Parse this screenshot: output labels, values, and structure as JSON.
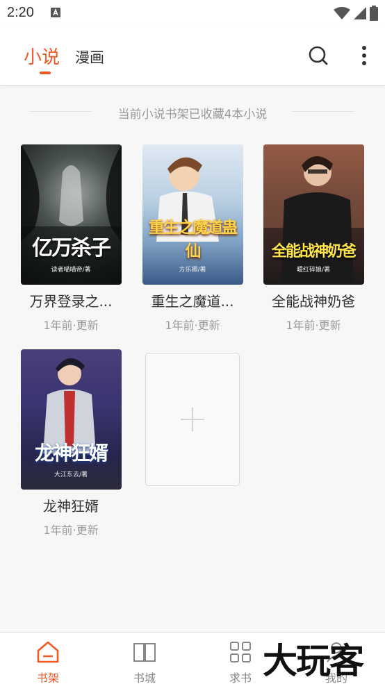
{
  "status": {
    "time": "2:20"
  },
  "header": {
    "tab_novel": "小说",
    "tab_comic": "漫画"
  },
  "shelf": {
    "summary": "当前小说书架已收藏4本小说"
  },
  "books": [
    {
      "title": "万界登录之...",
      "meta": "1年前·更新",
      "cover_text": "亿万杀子",
      "cover_author": "读者喵喵帝/著"
    },
    {
      "title": "重生之魔道...",
      "meta": "1年前·更新",
      "cover_text": "重生之魔道蛊仙",
      "cover_author": "方乐卿/著"
    },
    {
      "title": "全能战神奶爸",
      "meta": "1年前·更新",
      "cover_text": "全能战神奶爸",
      "cover_author": "暖红碎娘/著"
    },
    {
      "title": "龙神狂婿",
      "meta": "1年前·更新",
      "cover_text": "龙神狂婿",
      "cover_author": "大江东去/著"
    }
  ],
  "bottom_nav": {
    "items": [
      {
        "label": "书架"
      },
      {
        "label": "书城"
      },
      {
        "label": "求书"
      },
      {
        "label": "我的"
      }
    ]
  },
  "watermark": "大玩客",
  "colors": {
    "accent": "#f15a24",
    "muted": "#999999"
  }
}
